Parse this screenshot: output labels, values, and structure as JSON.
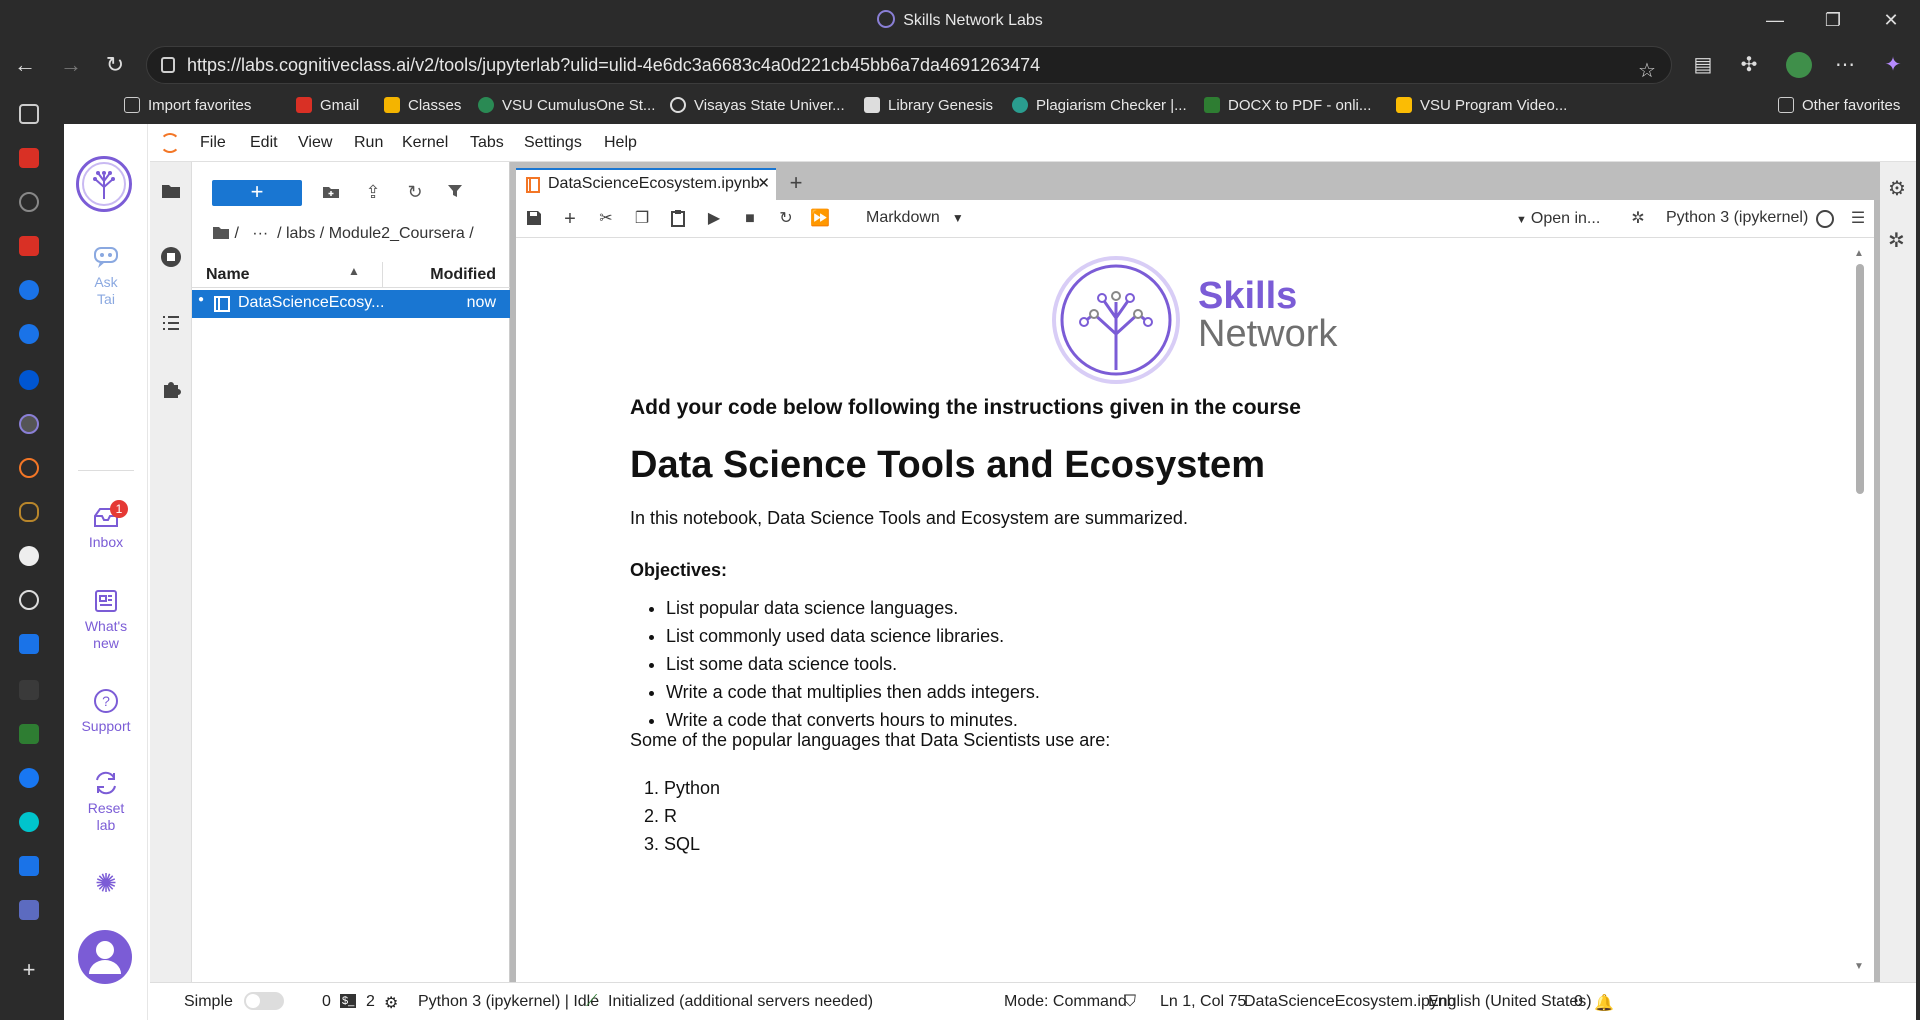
{
  "window": {
    "title": "Skills Network Labs"
  },
  "browser": {
    "url": "https://labs.cognitiveclass.ai/v2/tools/jupyterlab?ulid=ulid-4e6dc3a6683c4a0d221cb45bb6a7da4691263474",
    "favorites": [
      "Import favorites",
      "Gmail",
      "Classes",
      "VSU CumulusOne St...",
      "Visayas State Univer...",
      "Library Genesis",
      "Plagiarism Checker |...",
      "DOCX to PDF - onli...",
      "VSU Program Video..."
    ],
    "other_favorites": "Other favorites"
  },
  "rail": {
    "ask": "Ask",
    "tai": "Tai",
    "inbox": "Inbox",
    "inbox_badge": "1",
    "whats": "What's",
    "new": "new",
    "support": "Support",
    "reset": "Reset",
    "lab": "lab"
  },
  "menu": [
    "File",
    "Edit",
    "View",
    "Run",
    "Kernel",
    "Tabs",
    "Settings",
    "Help"
  ],
  "filebrowser": {
    "new": "+",
    "crumbs": "/   ···  / labs / Module2_Coursera /",
    "col_name": "Name",
    "col_modified": "Modified",
    "file_name": "DataScienceEcosy...",
    "file_modified": "now"
  },
  "tab": {
    "label": "DataScienceEcosystem.ipynb",
    "close": "✕",
    "add": "+"
  },
  "toolbar": {
    "cell_type": "Markdown",
    "open_in": "Open in...",
    "kernel": "Python 3 (ipykernel)"
  },
  "notebook": {
    "logo_line1": "Skills",
    "logo_line2": "Network",
    "intro": "Add your code below following the instructions given in the course",
    "title": "Data Science Tools and Ecosystem",
    "summary": "In this notebook, Data Science Tools and Ecosystem are summarized.",
    "objectives_title": "Objectives:",
    "objectives": [
      "List popular data science languages.",
      "List commonly used data science libraries.",
      "List some data science tools.",
      "Write a code that multiplies then adds integers.",
      "Write a code that converts hours to minutes."
    ],
    "languages_intro": "Some of the popular languages that Data Scientists use are:",
    "languages": [
      "Python",
      "R",
      "SQL"
    ]
  },
  "status": {
    "simple": "Simple",
    "count0": "0",
    "count2": "2",
    "kernel_status": "Python 3 (ipykernel) | Idle",
    "initialized": "Initialized (additional servers needed)",
    "mode": "Mode: Command",
    "position": "Ln 1, Col 75",
    "file": "DataScienceEcosystem.ipynb",
    "language": "English (United States)",
    "notifications": "0"
  },
  "colors": {
    "accent": "#1976d2",
    "brand": "#7b5cd6"
  }
}
